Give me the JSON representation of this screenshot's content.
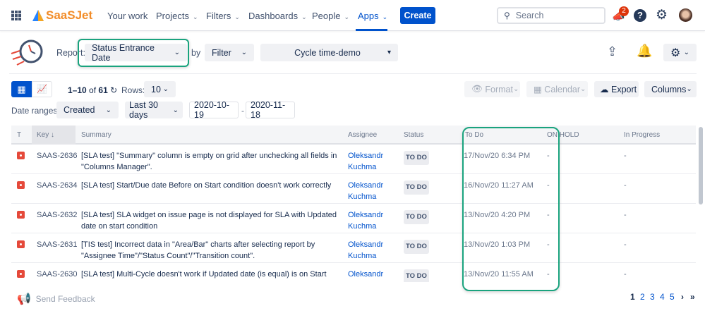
{
  "nav": {
    "brand": "SaaSJet",
    "items": [
      {
        "label": "Your work",
        "chevron": false
      },
      {
        "label": "Projects",
        "chevron": true
      },
      {
        "label": "Filters",
        "chevron": true
      },
      {
        "label": "Dashboards",
        "chevron": true
      },
      {
        "label": "People",
        "chevron": true
      },
      {
        "label": "Apps",
        "chevron": true,
        "active": true
      }
    ],
    "create": "Create",
    "search_placeholder": "Search",
    "notification_count": "2"
  },
  "report": {
    "label": "Report:",
    "value": "Status Entrance Date",
    "by": "by",
    "by_value": "Filter",
    "filter_value": "Cycle time-demo"
  },
  "toolbar": {
    "range_start": "1–10",
    "of": "of",
    "total": "61",
    "rows_label": "Rows:",
    "rows_value": "10",
    "format": "Format",
    "calendar": "Calendar",
    "export": "Export",
    "columns": "Columns"
  },
  "dates": {
    "label": "Date ranges:",
    "field": "Created",
    "period": "Last 30 days",
    "from": "2020-10-19",
    "sep": "-",
    "to": "2020-11-18"
  },
  "table": {
    "headers": [
      "T",
      "Key",
      "Summary",
      "Assignee",
      "Status",
      "To Do",
      "ON HOLD",
      "In Progress"
    ],
    "rows": [
      {
        "key": "SAAS-2636",
        "summary": "[SLA test] \"Summary\" column is empty on grid after unchecking all fields in \"Columns Manager\".",
        "assignee": "Oleksandr Kuchma",
        "status": "TO DO",
        "todo": "17/Nov/20 6:34 PM",
        "onhold": "-",
        "inprogress": "-"
      },
      {
        "key": "SAAS-2634",
        "summary": "[SLA test] Start/Due date Before on Start condition doesn't work correctly",
        "assignee": "Oleksandr Kuchma",
        "status": "TO DO",
        "todo": "16/Nov/20 11:27 AM",
        "onhold": "-",
        "inprogress": "-"
      },
      {
        "key": "SAAS-2632",
        "summary": "[SLA test] SLA widget on issue page is not displayed for SLA with Updated date on start condition",
        "assignee": "Oleksandr Kuchma",
        "status": "TO DO",
        "todo": "13/Nov/20 4:20 PM",
        "onhold": "-",
        "inprogress": "-"
      },
      {
        "key": "SAAS-2631",
        "summary": "[TIS test] Incorrect data in \"Area/Bar\" charts after selecting report by \"Assignee Time\"/\"Status Count\"/\"Transition count\".",
        "assignee": "Oleksandr Kuchma",
        "status": "TO DO",
        "todo": "13/Nov/20 1:03 PM",
        "onhold": "-",
        "inprogress": "-"
      },
      {
        "key": "SAAS-2630",
        "summary": "[SLA test] Multi-Cycle doesn't work if Updated date (is equal) is on Start condition",
        "assignee": "Oleksandr Kuchma",
        "status": "TO DO",
        "todo": "13/Nov/20 11:55 AM",
        "onhold": "-",
        "inprogress": "-"
      }
    ]
  },
  "footer": {
    "feedback": "Send Feedback",
    "pages": [
      "1",
      "2",
      "3",
      "4",
      "5"
    ],
    "current_page": "1",
    "next": "›",
    "last": "»"
  },
  "colors": {
    "accent": "#0052cc",
    "highlight": "#1aa37e",
    "bug": "#e5493a"
  }
}
